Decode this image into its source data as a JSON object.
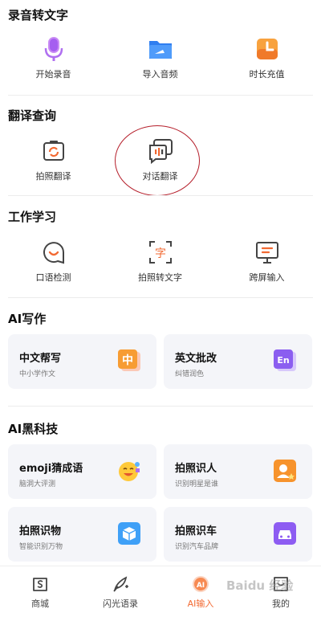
{
  "sections": {
    "record": {
      "title": "录音转文字",
      "items": [
        {
          "label": "开始录音",
          "icon": "microphone-icon"
        },
        {
          "label": "导入音频",
          "icon": "folder-icon"
        },
        {
          "label": "时长充值",
          "icon": "clock-icon"
        }
      ]
    },
    "translate": {
      "title": "翻译查询",
      "items": [
        {
          "label": "拍照翻译",
          "icon": "camera-translate-icon"
        },
        {
          "label": "对话翻译",
          "icon": "dialog-translate-icon"
        }
      ]
    },
    "work": {
      "title": "工作学习",
      "items": [
        {
          "label": "口语检测",
          "icon": "speech-check-icon"
        },
        {
          "label": "拍照转文字",
          "icon": "photo-text-icon"
        },
        {
          "label": "跨屏输入",
          "icon": "cross-screen-icon"
        }
      ]
    },
    "ai_write": {
      "title": "AI写作",
      "cards": [
        {
          "title": "中文帮写",
          "subtitle": "中小学作文",
          "icon_text": "中",
          "icon": "chinese-write-icon"
        },
        {
          "title": "英文批改",
          "subtitle": "纠错润色",
          "icon_text": "En",
          "icon": "english-correct-icon"
        }
      ]
    },
    "ai_tech": {
      "title": "AI黑科技",
      "cards": [
        {
          "title": "emoji猜成语",
          "subtitle": "脑洞大评测",
          "icon": "emoji-icon"
        },
        {
          "title": "拍照识人",
          "subtitle": "识别明星是谁",
          "icon": "person-id-icon"
        },
        {
          "title": "拍照识物",
          "subtitle": "智能识别万物",
          "icon": "object-id-icon"
        },
        {
          "title": "拍照识车",
          "subtitle": "识别汽车品牌",
          "icon": "car-id-icon"
        }
      ]
    }
  },
  "tabbar": {
    "items": [
      {
        "label": "商城",
        "icon": "shop-icon"
      },
      {
        "label": "闪光语录",
        "icon": "quill-icon"
      },
      {
        "label": "AI输入",
        "icon": "ai-input-icon",
        "active": true
      },
      {
        "label": "我的",
        "icon": "profile-icon"
      }
    ]
  },
  "watermark": "Baidu 经验",
  "colors": {
    "accent": "#f26a33",
    "purple": "#b070f0",
    "blue": "#3a8ef6",
    "orange": "#f7922e",
    "annotation_red": "#b51e2a"
  }
}
